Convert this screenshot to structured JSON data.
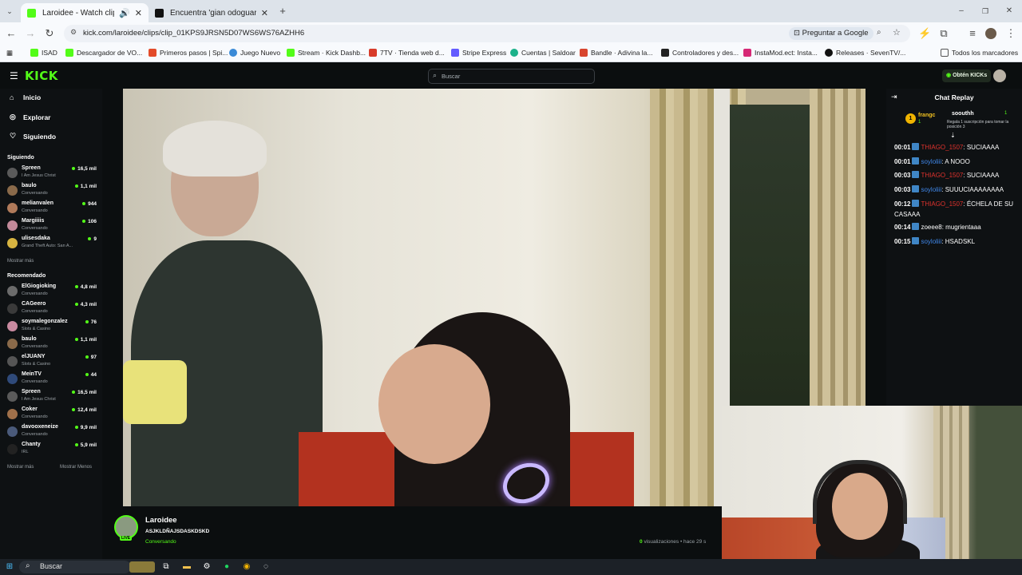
{
  "browser": {
    "tabs": [
      {
        "title": "Laroidee - Watch clips on K",
        "active": true
      },
      {
        "title": "Encuentra 'gian odoguardi' en",
        "active": false
      }
    ],
    "url": "kick.com/laroidee/clips/clip_01KPS9JRSN5D07WS6WS76AZHH6",
    "ask_google": "Preguntar a Google",
    "bookmarks": [
      "ISAD",
      "Descargador de VO...",
      "Primeros pasos | Spi...",
      "Juego Nuevo",
      "Stream · Kick Dashb...",
      "7TV · Tienda web d...",
      "Stripe Express",
      "Cuentas | Saldoar",
      "Bandle · Adivina la...",
      "Controladores y des...",
      "InstaMod.ect: Insta...",
      "Releases · SevenTV/..."
    ],
    "all_bookmarks": "Todos los marcadores"
  },
  "kick": {
    "logo": "KICK",
    "search_placeholder": "Buscar",
    "get_kicks": "Obtén KICKs",
    "nav": [
      {
        "label": "Inicio",
        "icon": "home-icon"
      },
      {
        "label": "Explorar",
        "icon": "compass-icon"
      },
      {
        "label": "Siguiendo",
        "icon": "heart-icon"
      }
    ],
    "following_title": "Siguiendo",
    "following": [
      {
        "name": "Spreen",
        "cat": "I Am Jesus Christ",
        "viewers": "16,5 mil",
        "color": "#5a5a5a"
      },
      {
        "name": "baulo",
        "cat": "Conversando",
        "viewers": "1,1 mil",
        "color": "#8a6a4a"
      },
      {
        "name": "melianvalen",
        "cat": "Conversando",
        "viewers": "944",
        "color": "#b07a5a"
      },
      {
        "name": "Margiiiis",
        "cat": "Conversando",
        "viewers": "106",
        "color": "#c28a9a"
      },
      {
        "name": "ulisesdaka",
        "cat": "Grand Theft Auto: San A...",
        "viewers": "9",
        "color": "#d7b441"
      }
    ],
    "show_more": "Mostrar más",
    "recommended_title": "Recomendado",
    "recommended": [
      {
        "name": "ElGiogioking",
        "cat": "Conversando",
        "viewers": "4,8 mil",
        "color": "#6b6b6b"
      },
      {
        "name": "CAGeero",
        "cat": "Conversando",
        "viewers": "4,3 mil",
        "color": "#3a3a3a"
      },
      {
        "name": "soymalegonzalez",
        "cat": "Slots & Casino",
        "viewers": "76",
        "color": "#c98aa0"
      },
      {
        "name": "baulo",
        "cat": "Conversando",
        "viewers": "1,1 mil",
        "color": "#8a6a4a"
      },
      {
        "name": "elJUANY",
        "cat": "Slots & Casino",
        "viewers": "97",
        "color": "#555"
      },
      {
        "name": "MeinTV",
        "cat": "Conversando",
        "viewers": "44",
        "color": "#2f4a7a"
      },
      {
        "name": "Spreen",
        "cat": "I Am Jesus Christ",
        "viewers": "16,5 mil",
        "color": "#5a5a5a"
      },
      {
        "name": "Coker",
        "cat": "Conversando",
        "viewers": "12,4 mil",
        "color": "#a0704a"
      },
      {
        "name": "davooxeneize",
        "cat": "Conversando",
        "viewers": "9,9 mil",
        "color": "#4a5a7a"
      },
      {
        "name": "Chanty",
        "cat": "IRL",
        "viewers": "5,9 mil",
        "color": "#222"
      }
    ],
    "show_more2": "Mostrar más",
    "show_less": "Mostrar Menos"
  },
  "chat": {
    "title": "Chat Replay",
    "pinned_user": "frangc",
    "pinned_count": "1",
    "pinned_user2": "soouthh",
    "pinned_count2": "1",
    "pinned_text": "Regala 1 suscripción para tomar la posición 3",
    "messages": [
      {
        "time": "00:01",
        "user": "THIAGO_1507",
        "cls": "u1",
        "text": "SUCIAAAA"
      },
      {
        "time": "00:01",
        "user": "soyloliii",
        "cls": "u2",
        "text": "A NOOO"
      },
      {
        "time": "00:03",
        "user": "THIAGO_1507",
        "cls": "u1",
        "text": "SUCIAAAA"
      },
      {
        "time": "00:03",
        "user": "soyloliii",
        "cls": "u2",
        "text": "SUUUCIAAAAAAAA"
      },
      {
        "time": "00:12",
        "user": "THIAGO_1507",
        "cls": "u1",
        "text": "ÉCHELA DE SU CASAAA"
      },
      {
        "time": "00:14",
        "user": "zoeee8",
        "cls": "u3",
        "text": "mugrientaaa"
      },
      {
        "time": "00:15",
        "user": "soyloliii",
        "cls": "u2",
        "text": "HSADSKL"
      }
    ]
  },
  "clip": {
    "streamer": "Laroidee",
    "live_badge": "LIVE",
    "title": "ASJKLDÑAJSDASKDSKD",
    "category": "Conversando",
    "views_count": "0",
    "views_label": "visualizaciones",
    "ago": "• hace 29 s"
  },
  "taskbar": {
    "search": "Buscar"
  }
}
